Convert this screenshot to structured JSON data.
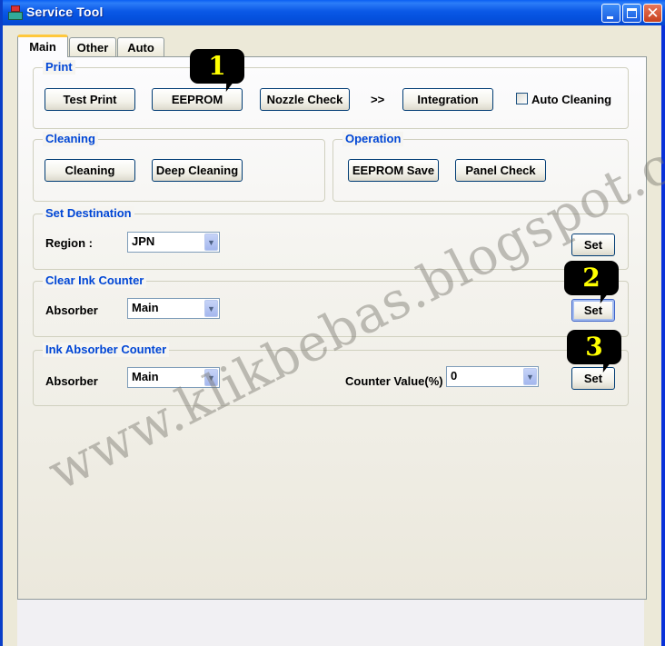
{
  "window": {
    "title": "Service Tool",
    "controls": {
      "minimize": "minimize",
      "maximize": "maximize",
      "close": "✕"
    }
  },
  "tabs": [
    {
      "label": "Main",
      "active": true
    },
    {
      "label": "Other",
      "active": false
    },
    {
      "label": "Auto",
      "active": false
    }
  ],
  "print": {
    "title": "Print",
    "test_print": "Test Print",
    "eeprom": "EEPROM",
    "nozzle_check": "Nozzle Check",
    "arrow": ">>",
    "integration": "Integration",
    "auto_cleaning_label": "Auto Cleaning",
    "auto_cleaning_checked": false
  },
  "cleaning": {
    "title": "Cleaning",
    "cleaning": "Cleaning",
    "deep_cleaning": "Deep Cleaning"
  },
  "operation": {
    "title": "Operation",
    "eeprom_save": "EEPROM Save",
    "panel_check": "Panel Check"
  },
  "set_destination": {
    "title": "Set Destination",
    "region_label": "Region :",
    "region_value": "JPN",
    "set": "Set"
  },
  "clear_ink_counter": {
    "title": "Clear Ink Counter",
    "absorber_label": "Absorber",
    "absorber_value": "Main",
    "set": "Set"
  },
  "ink_absorber_counter": {
    "title": "Ink Absorber Counter",
    "absorber_label": "Absorber",
    "absorber_value": "Main",
    "counter_value_label": "Counter Value(%)",
    "counter_value": "0",
    "set": "Set"
  },
  "callouts": [
    "1",
    "2",
    "3"
  ],
  "watermark": "www.klikbebas.blogspot.com",
  "colors": {
    "titlebar": "#0a58e6",
    "group_title": "#0046d5",
    "callout_bg": "#000000",
    "callout_text": "#ffff00",
    "tab_active_accent": "#ffc83c"
  }
}
